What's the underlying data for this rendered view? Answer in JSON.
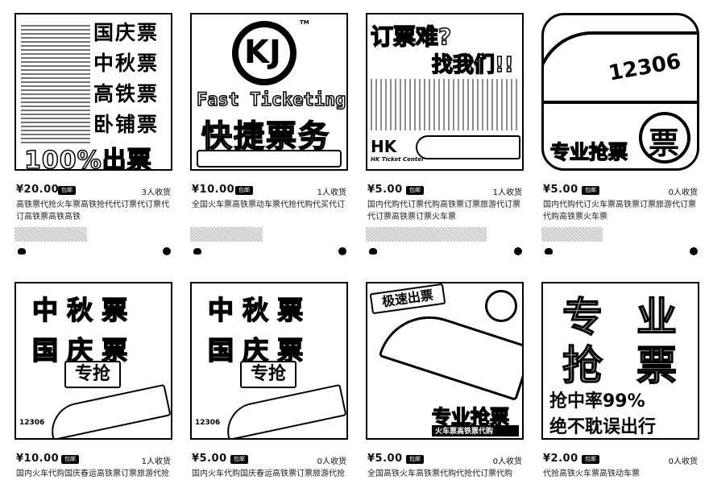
{
  "cards": [
    {
      "price": "¥20.00",
      "badge": "包邮",
      "sold": "3人收货",
      "title": "高铁票代抢火车票高铁抢代代订票代订票代订高铁票高铁高铁",
      "thumb": {
        "lines": [
          "国庆票",
          "中秋票",
          "高铁票",
          "卧铺票"
        ],
        "banner": "100%出票"
      }
    },
    {
      "price": "¥10.00",
      "badge": "包邮",
      "sold": "1人收货",
      "title": "全国火车票高铁票动车票代抢代购代买代订",
      "thumb": {
        "logo": "KJ",
        "tm": "TM",
        "en": "Fast Ticketing",
        "cn": "快捷票务"
      }
    },
    {
      "price": "¥5.00",
      "badge": "包邮",
      "sold": "1人收货",
      "title": "国内代购代订票代购高铁票订票旅游代订票代订票高铁票订票火车票",
      "thumb": {
        "top": "订票难?",
        "sub": "找我们!!",
        "hk": "HK",
        "hk_sub": "HK Ticket Center"
      }
    },
    {
      "price": "¥5.00",
      "badge": "包邮",
      "sold": "0人收货",
      "title": "国内代购代订火车票高铁票订票旅游代订票代购高铁票火车票",
      "thumb": {
        "number": "12306",
        "caption": "专业抢票",
        "seal": "票"
      }
    },
    {
      "price": "¥10.00",
      "badge": "包邮",
      "sold": "1人收货",
      "title": "国内火车代购国庆春运高铁票订票旅游代抢",
      "thumb": {
        "lines": [
          "中 秋 票",
          "国 庆 票"
        ],
        "button": "专抢",
        "num": "12306"
      }
    },
    {
      "price": "¥5.00",
      "badge": "包邮",
      "sold": "0人收货",
      "title": "国内火车代购国庆春运高铁票订票旅游代抢",
      "thumb": {
        "lines": [
          "中 秋 票",
          "国 庆 票"
        ],
        "button": "专抢",
        "num": "12306"
      }
    },
    {
      "price": "¥5.00",
      "badge": "包邮",
      "sold": "0人收货",
      "title": "全国高铁火车高铁票代购代抢代订票代购",
      "thumb": {
        "tag": "极速出票",
        "caption": "专业抢票",
        "sub": "火车票高铁票代购"
      }
    },
    {
      "price": "¥2.00",
      "badge": "包邮",
      "sold": "0人收货",
      "title": "代抢高铁火车票高铁动车票",
      "thumb": {
        "big": [
          "专",
          "业",
          "抢",
          "票"
        ],
        "l1": "抢中率99%",
        "l2": "绝不耽误出行"
      }
    }
  ]
}
